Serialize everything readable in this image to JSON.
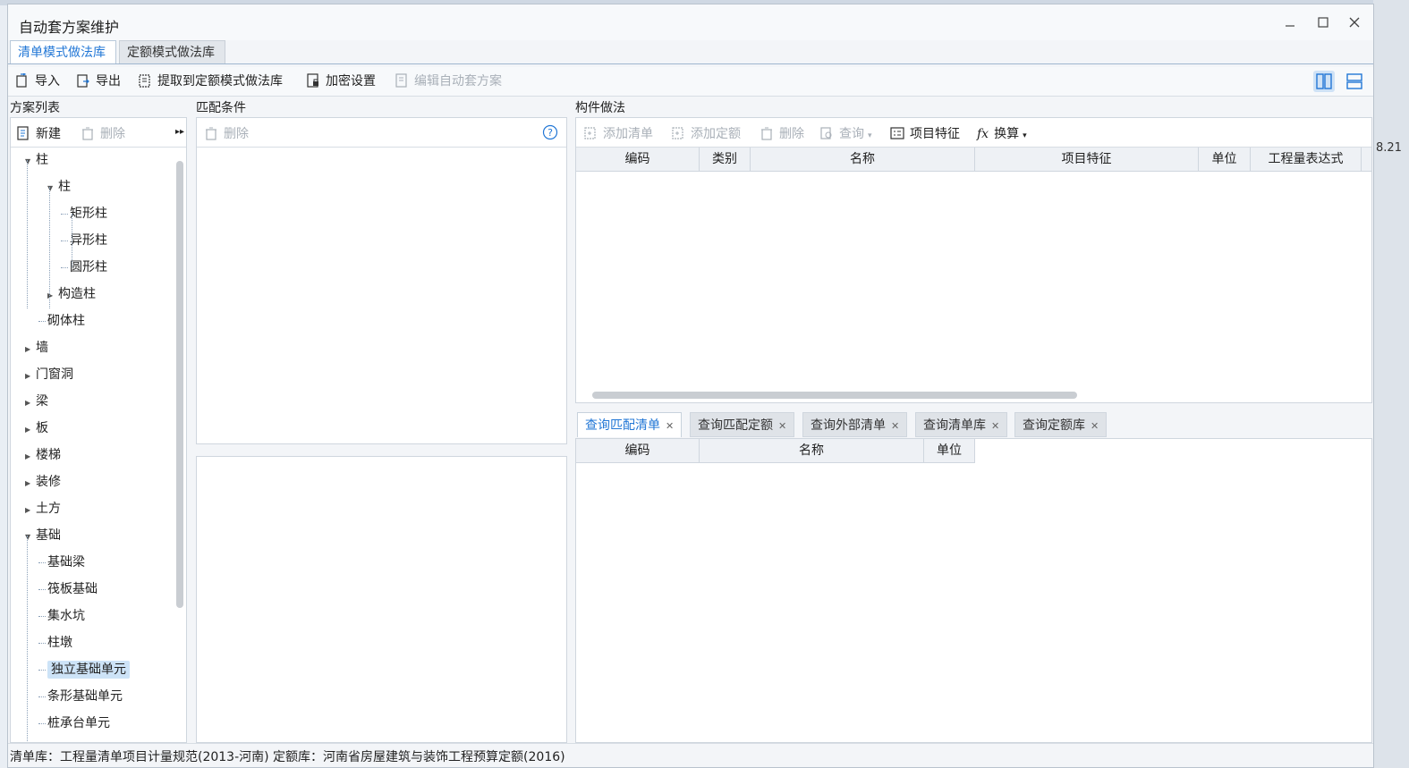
{
  "window": {
    "title": "自动套方案维护"
  },
  "tabs": [
    {
      "label": "清单模式做法库",
      "active": true
    },
    {
      "label": "定额模式做法库",
      "active": false
    }
  ],
  "toolbar": {
    "import_label": "导入",
    "export_label": "导出",
    "extract_label": "提取到定额模式做法库",
    "encrypt_label": "加密设置",
    "edit_label": "编辑自动套方案"
  },
  "scheme_list": {
    "title": "方案列表",
    "new_label": "新建",
    "delete_label": "删除",
    "tree": [
      {
        "label": "柱",
        "level": 0,
        "expanded": true
      },
      {
        "label": "柱",
        "level": 1,
        "expanded": true
      },
      {
        "label": "矩形柱",
        "level": 2
      },
      {
        "label": "异形柱",
        "level": 2
      },
      {
        "label": "圆形柱",
        "level": 2
      },
      {
        "label": "构造柱",
        "level": 1,
        "expanded": false
      },
      {
        "label": "砌体柱",
        "level": 1
      },
      {
        "label": "墙",
        "level": 0,
        "expanded": false
      },
      {
        "label": "门窗洞",
        "level": 0,
        "expanded": false
      },
      {
        "label": "梁",
        "level": 0,
        "expanded": false
      },
      {
        "label": "板",
        "level": 0,
        "expanded": false
      },
      {
        "label": "楼梯",
        "level": 0,
        "expanded": false
      },
      {
        "label": "装修",
        "level": 0,
        "expanded": false
      },
      {
        "label": "土方",
        "level": 0,
        "expanded": false
      },
      {
        "label": "基础",
        "level": 0,
        "expanded": true
      },
      {
        "label": "基础梁",
        "level": 1
      },
      {
        "label": "筏板基础",
        "level": 1
      },
      {
        "label": "集水坑",
        "level": 1
      },
      {
        "label": "柱墩",
        "level": 1
      },
      {
        "label": "独立基础单元",
        "level": 1,
        "selected": true
      },
      {
        "label": "条形基础单元",
        "level": 1
      },
      {
        "label": "桩承台单元",
        "level": 1
      }
    ]
  },
  "match": {
    "title": "匹配条件",
    "delete_label": "删除"
  },
  "method": {
    "title": "构件做法",
    "add_list_label": "添加清单",
    "add_quota_label": "添加定额",
    "delete_label": "删除",
    "query_label": "查询",
    "feature_label": "项目特征",
    "convert_label": "换算",
    "columns": [
      "编码",
      "类别",
      "名称",
      "项目特征",
      "单位",
      "工程量表达式"
    ]
  },
  "query": {
    "tabs": [
      {
        "label": "查询匹配清单",
        "active": true
      },
      {
        "label": "查询匹配定额",
        "active": false
      },
      {
        "label": "查询外部清单",
        "active": false
      },
      {
        "label": "查询清单库",
        "active": false
      },
      {
        "label": "查询定额库",
        "active": false
      }
    ],
    "columns": [
      "编码",
      "名称",
      "单位"
    ]
  },
  "status": {
    "text": "清单库：工程量清单项目计量规范(2013-河南) 定额库：河南省房屋建筑与装饰工程预算定额(2016)"
  },
  "background": {
    "fragment": "8.21"
  },
  "colors": {
    "accent": "#2277d6",
    "selected": "#cde3f7",
    "disabled": "#a9b0b8"
  }
}
